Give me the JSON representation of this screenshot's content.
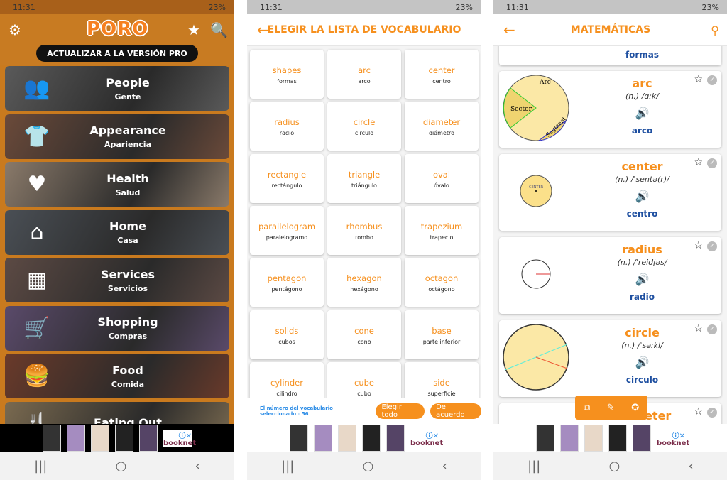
{
  "status": {
    "time": "11:31",
    "battery": "23%"
  },
  "nav": {
    "recents": "|||",
    "home": "○",
    "back": "‹"
  },
  "ad": {
    "brand": "booknet",
    "info": "ⓘ✕"
  },
  "home": {
    "logo": "PORO",
    "pro_button": "ACTUALIZAR A LA VERSIÓN PRO",
    "categories": [
      {
        "en": "People",
        "es": "Gente",
        "icon": "people-icon",
        "glyph": "👥",
        "bg": "#5a5a5a"
      },
      {
        "en": "Appearance",
        "es": "Apariencia",
        "icon": "clothes-icon",
        "glyph": "👕",
        "bg": "#6b4a3a"
      },
      {
        "en": "Health",
        "es": "Salud",
        "icon": "heart-pulse-icon",
        "glyph": "♥",
        "bg": "#8a7a6a"
      },
      {
        "en": "Home",
        "es": "Casa",
        "icon": "house-icon",
        "glyph": "⌂",
        "bg": "#4a4f55"
      },
      {
        "en": "Services",
        "es": "Servicios",
        "icon": "hotel-icon",
        "glyph": "▦",
        "bg": "#5c4a44"
      },
      {
        "en": "Shopping",
        "es": "Compras",
        "icon": "cart-icon",
        "glyph": "🛒",
        "bg": "#5a4a6a"
      },
      {
        "en": "Food",
        "es": "Comida",
        "icon": "burger-drink-icon",
        "glyph": "🍔",
        "bg": "#6a3a2a"
      },
      {
        "en": "Eating Out",
        "es": "",
        "icon": "fork-plate-icon",
        "glyph": "🍴",
        "bg": "#7a6a50"
      }
    ]
  },
  "vocab": {
    "title": "ELEGIR LA LISTA DE VOCABULARIO",
    "items": [
      {
        "en": "shapes",
        "es": "formas"
      },
      {
        "en": "arc",
        "es": "arco"
      },
      {
        "en": "center",
        "es": "centro"
      },
      {
        "en": "radius",
        "es": "radio"
      },
      {
        "en": "circle",
        "es": "circulo"
      },
      {
        "en": "diameter",
        "es": "diámetro"
      },
      {
        "en": "rectangle",
        "es": "rectángulo"
      },
      {
        "en": "triangle",
        "es": "triángulo"
      },
      {
        "en": "oval",
        "es": "óvalo"
      },
      {
        "en": "parallelogram",
        "es": "paralelogramo"
      },
      {
        "en": "rhombus",
        "es": "rombo"
      },
      {
        "en": "trapezium",
        "es": "trapecio"
      },
      {
        "en": "pentagon",
        "es": "pentágono"
      },
      {
        "en": "hexagon",
        "es": "hexágono"
      },
      {
        "en": "octagon",
        "es": "octágono"
      },
      {
        "en": "solids",
        "es": "cubos"
      },
      {
        "en": "cone",
        "es": "cono"
      },
      {
        "en": "base",
        "es": "parte inferior"
      },
      {
        "en": "cylinder",
        "es": "cilindro"
      },
      {
        "en": "cube",
        "es": "cubo"
      },
      {
        "en": "side",
        "es": "superficie"
      }
    ],
    "count_label": "El número del vocabulario seleccionado : 56",
    "select_all": "Elegir todo",
    "ok": "De acuerdo"
  },
  "math": {
    "title": "MATEMÁTICAS",
    "top_partial": "formas",
    "words": [
      {
        "en": "arc",
        "ph": "(n.)  /ɑːk/",
        "es": "arco",
        "labels": [
          "Arc",
          "Sector",
          "Segment"
        ]
      },
      {
        "en": "center",
        "ph": "(n.)  /ˈsentə(r)/",
        "es": "centro",
        "labels": [
          "CENTER"
        ]
      },
      {
        "en": "radius",
        "ph": "(n.)  /ˈreidjəs/",
        "es": "radio",
        "labels": []
      },
      {
        "en": "circle",
        "ph": "(n.)  /ˈsəːkl/",
        "es": "circulo",
        "labels": []
      },
      {
        "en": "diameter",
        "ph": "",
        "es": "",
        "labels": []
      }
    ]
  },
  "colors": {
    "accent": "#f6901e",
    "translation": "#1e4fa0",
    "count": "#2b8ce6"
  }
}
